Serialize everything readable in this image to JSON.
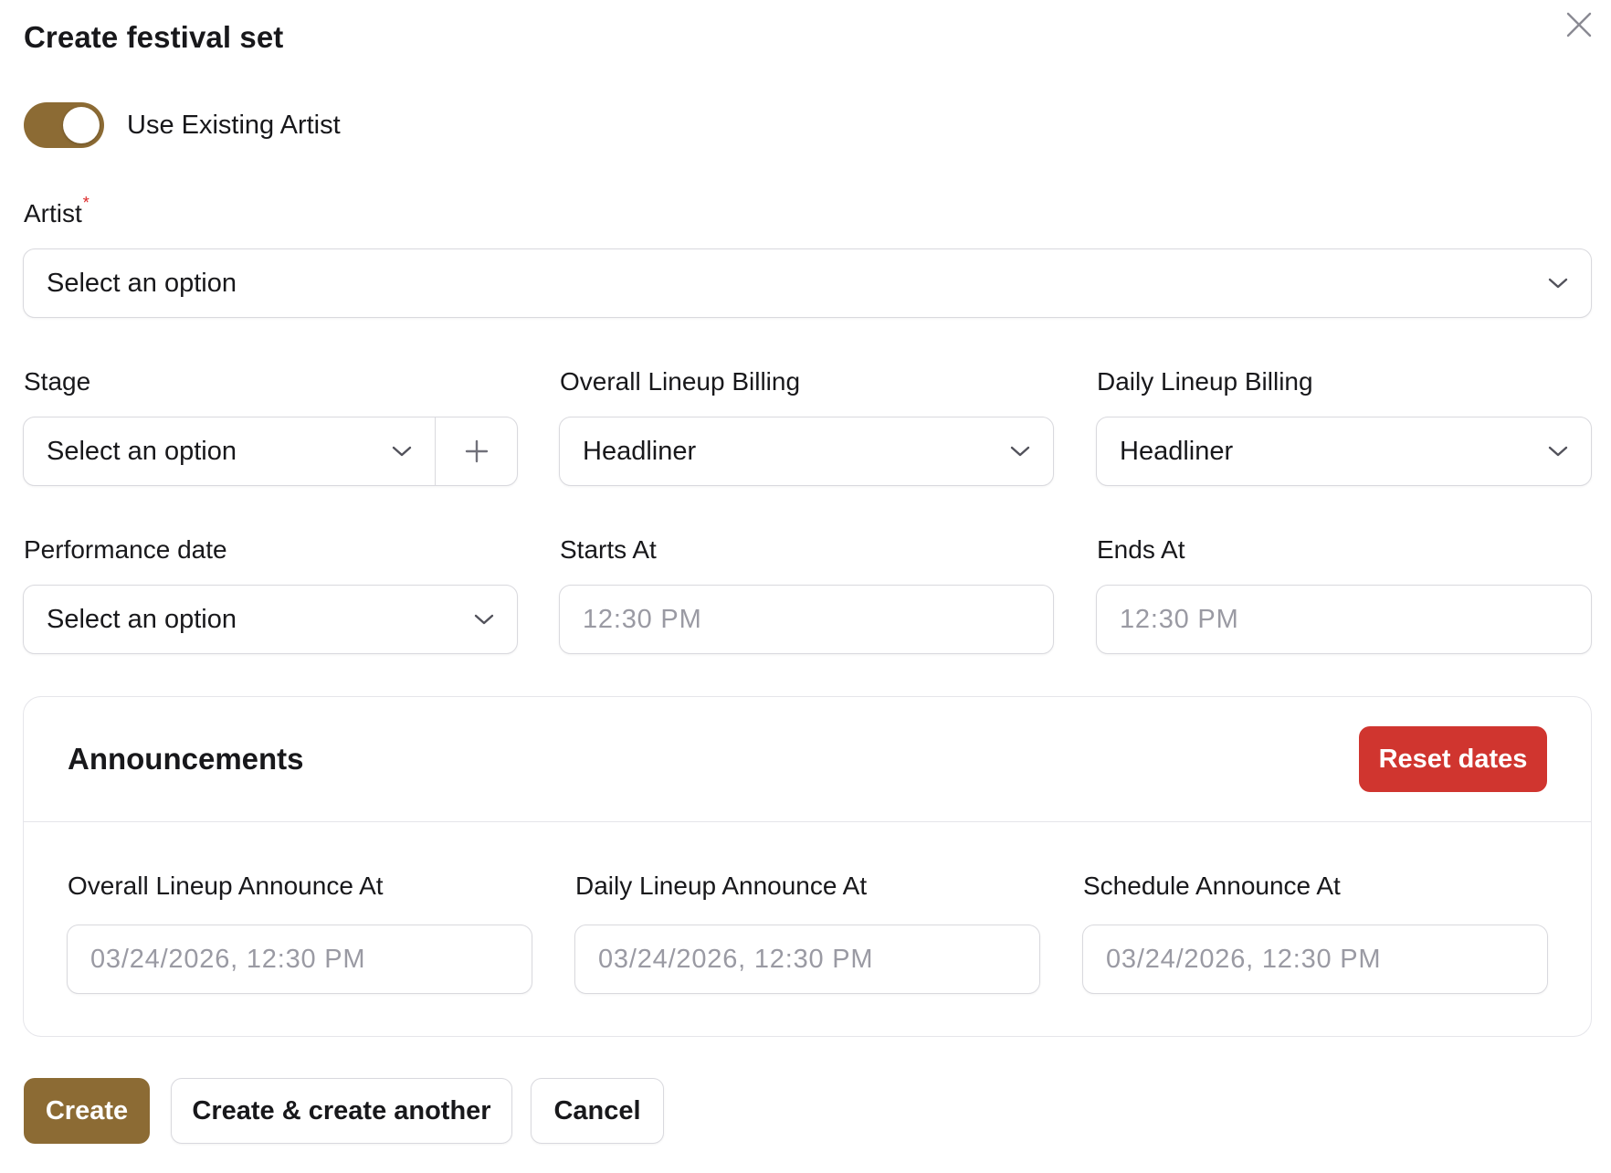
{
  "colors": {
    "brand": "#8c6b34",
    "danger": "#d0352f"
  },
  "modal": {
    "title": "Create festival set",
    "close_icon": "close-icon"
  },
  "toggle": {
    "label": "Use Existing Artist",
    "on": true
  },
  "artist": {
    "label": "Artist",
    "required_mark": "*",
    "value": "Select an option"
  },
  "stage": {
    "label": "Stage",
    "value": "Select an option",
    "add_icon": "plus-icon"
  },
  "overall_billing": {
    "label": "Overall Lineup Billing",
    "value": "Headliner"
  },
  "daily_billing": {
    "label": "Daily Lineup Billing",
    "value": "Headliner"
  },
  "performance_date": {
    "label": "Performance date",
    "value": "Select an option"
  },
  "starts_at": {
    "label": "Starts At",
    "placeholder": "12:30 PM"
  },
  "ends_at": {
    "label": "Ends At",
    "placeholder": "12:30 PM"
  },
  "announcements": {
    "title": "Announcements",
    "reset_label": "Reset dates",
    "overall": {
      "label": "Overall Lineup Announce At",
      "placeholder": "03/24/2026, 12:30 PM"
    },
    "daily": {
      "label": "Daily Lineup Announce At",
      "placeholder": "03/24/2026, 12:30 PM"
    },
    "schedule": {
      "label": "Schedule Announce At",
      "placeholder": "03/24/2026, 12:30 PM"
    }
  },
  "actions": {
    "create": "Create",
    "create_another": "Create & create another",
    "cancel": "Cancel"
  }
}
